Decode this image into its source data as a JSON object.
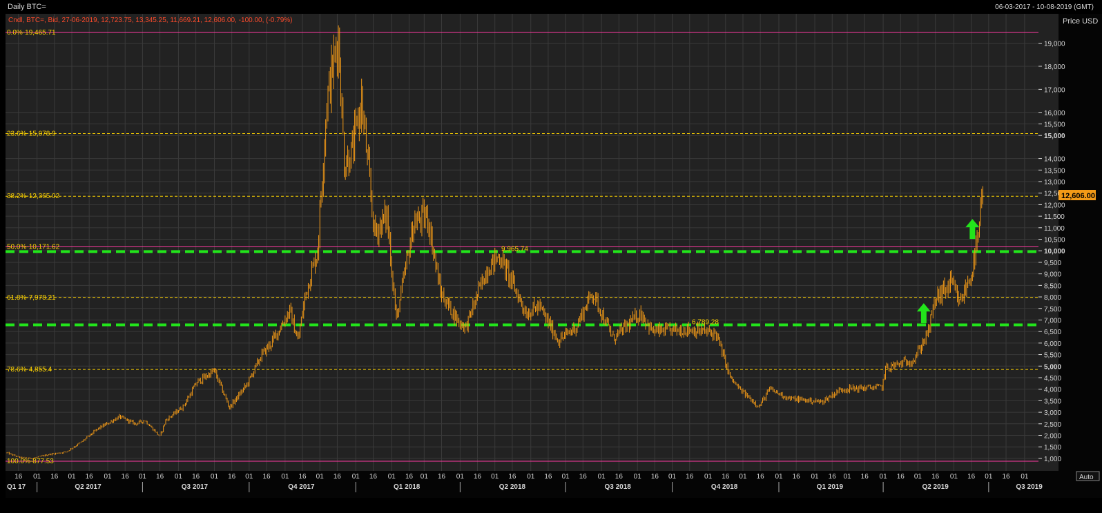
{
  "window": {
    "title": "Daily BTC=",
    "date_range": "06-03-2017 - 10-08-2019 (GMT)",
    "info": "Cndl, BTC=, Bid, 27-06-2019, 12,723.75, 13,345.25, 11,669.21, 12,606.00, -100.00, (-0.79%)"
  },
  "colors": {
    "background": "#000000",
    "plot_background": "#222222",
    "grid": "#3a3a3a",
    "candle": "#f39a17",
    "fibonacci": "#ffd400",
    "fib_end": "#ff3aa1",
    "support": "#22e51b",
    "text": "#d8d8d8",
    "info": "#ff4b2b"
  },
  "chart_data": {
    "type": "candlestick",
    "title": "Daily BTC=",
    "ylabel": "Price USD",
    "last_price": "12,606.00",
    "y_axis_mode": "Auto",
    "ylim": [
      650,
      19700
    ],
    "x_range": [
      "2017-03-06",
      "2019-08-10"
    ],
    "y_ticks": [
      {
        "label": "19,000",
        "value": 19000
      },
      {
        "label": "18,000",
        "value": 18000
      },
      {
        "label": "17,000",
        "value": 17000
      },
      {
        "label": "16,000",
        "value": 16000
      },
      {
        "label": "15,500",
        "value": 15500
      },
      {
        "label": "15,000",
        "value": 15000
      },
      {
        "label": "14,000",
        "value": 14000
      },
      {
        "label": "13,500",
        "value": 13500
      },
      {
        "label": "13,000",
        "value": 13000
      },
      {
        "label": "12,500",
        "value": 12500
      },
      {
        "label": "12,000",
        "value": 12000
      },
      {
        "label": "11,500",
        "value": 11500
      },
      {
        "label": "11,000",
        "value": 11000
      },
      {
        "label": "10,500",
        "value": 10500
      },
      {
        "label": "10,000",
        "value": 10000
      },
      {
        "label": "9,500",
        "value": 9500
      },
      {
        "label": "9,000",
        "value": 9000
      },
      {
        "label": "8,500",
        "value": 8500
      },
      {
        "label": "8,000",
        "value": 8000
      },
      {
        "label": "7,500",
        "value": 7500
      },
      {
        "label": "7,000",
        "value": 7000
      },
      {
        "label": "6,500",
        "value": 6500
      },
      {
        "label": "6,000",
        "value": 6000
      },
      {
        "label": "5,500",
        "value": 5500
      },
      {
        "label": "5,000",
        "value": 5000
      },
      {
        "label": "4,500",
        "value": 4500
      },
      {
        "label": "4,000",
        "value": 4000
      },
      {
        "label": "3,500",
        "value": 3500
      },
      {
        "label": "3,000",
        "value": 3000
      },
      {
        "label": "2,500",
        "value": 2500
      },
      {
        "label": "2,000",
        "value": 2000
      },
      {
        "label": "1,500",
        "value": 1500
      },
      {
        "label": "1,000",
        "value": 1000
      }
    ],
    "fibonacci_levels": [
      {
        "label": "0.0%",
        "value": 19465.71,
        "value_label": "19,465.71",
        "style": "solid"
      },
      {
        "label": "23.6%",
        "value": 15078.9,
        "value_label": "15,078.9",
        "style": "dashed"
      },
      {
        "label": "38.2%",
        "value": 12365.02,
        "value_label": "12,365.02",
        "style": "dashed"
      },
      {
        "label": "50.0%",
        "value": 10171.62,
        "value_label": "10,171.62",
        "style": "solid"
      },
      {
        "label": "61.8%",
        "value": 7978.21,
        "value_label": "7,978.21",
        "style": "dashed"
      },
      {
        "label": "78.6%",
        "value": 4855.4,
        "value_label": "4,855.4",
        "style": "dashed"
      },
      {
        "label": "100.0%",
        "value": 877.53,
        "value_label": "877.53",
        "style": "solid"
      }
    ],
    "support_lines": [
      {
        "value": 9965.74,
        "label": "9,965.74"
      },
      {
        "value": 6789.28,
        "label": "6,789.28"
      }
    ],
    "arrows": [
      {
        "date": "2019-05-06",
        "value": 7250
      },
      {
        "date": "2019-06-17",
        "value": 10900
      }
    ],
    "quarters": [
      {
        "label": "Q1 17",
        "date": "2017-03-06"
      },
      {
        "label": "Q2 2017",
        "date": "2017-05-15"
      },
      {
        "label": "Q3 2017",
        "date": "2017-08-15"
      },
      {
        "label": "Q4 2017",
        "date": "2017-11-15"
      },
      {
        "label": "Q1 2018",
        "date": "2018-02-14"
      },
      {
        "label": "Q2 2018",
        "date": "2018-05-16"
      },
      {
        "label": "Q3 2018",
        "date": "2018-08-15"
      },
      {
        "label": "Q4 2018",
        "date": "2018-11-15"
      },
      {
        "label": "Q1 2019",
        "date": "2019-02-14"
      },
      {
        "label": "Q2 2019",
        "date": "2019-05-16"
      },
      {
        "label": "Q3 2019",
        "date": "2019-08-05"
      }
    ],
    "quarter_boundaries": [
      "2017-04-01",
      "2017-07-01",
      "2017-10-01",
      "2018-01-01",
      "2018-04-01",
      "2018-07-01",
      "2018-10-01",
      "2019-01-01",
      "2019-04-01",
      "2019-07-01"
    ],
    "x_tick_labels": [
      {
        "label": "16",
        "date": "2017-03-16"
      },
      {
        "label": "01",
        "date": "2017-04-01"
      },
      {
        "label": "16",
        "date": "2017-04-16"
      },
      {
        "label": "01",
        "date": "2017-05-01"
      },
      {
        "label": "16",
        "date": "2017-05-16"
      },
      {
        "label": "01",
        "date": "2017-06-01"
      },
      {
        "label": "16",
        "date": "2017-06-16"
      },
      {
        "label": "01",
        "date": "2017-07-01"
      },
      {
        "label": "16",
        "date": "2017-07-16"
      },
      {
        "label": "01",
        "date": "2017-08-01"
      },
      {
        "label": "16",
        "date": "2017-08-16"
      },
      {
        "label": "01",
        "date": "2017-09-01"
      },
      {
        "label": "16",
        "date": "2017-09-16"
      },
      {
        "label": "01",
        "date": "2017-10-01"
      },
      {
        "label": "16",
        "date": "2017-10-16"
      },
      {
        "label": "01",
        "date": "2017-11-01"
      },
      {
        "label": "16",
        "date": "2017-11-16"
      },
      {
        "label": "01",
        "date": "2017-12-01"
      },
      {
        "label": "16",
        "date": "2017-12-16"
      },
      {
        "label": "01",
        "date": "2018-01-01"
      },
      {
        "label": "16",
        "date": "2018-01-16"
      },
      {
        "label": "01",
        "date": "2018-02-01"
      },
      {
        "label": "16",
        "date": "2018-02-16"
      },
      {
        "label": "01",
        "date": "2018-03-01"
      },
      {
        "label": "16",
        "date": "2018-03-16"
      },
      {
        "label": "01",
        "date": "2018-04-01"
      },
      {
        "label": "16",
        "date": "2018-04-16"
      },
      {
        "label": "01",
        "date": "2018-05-01"
      },
      {
        "label": "16",
        "date": "2018-05-16"
      },
      {
        "label": "01",
        "date": "2018-06-01"
      },
      {
        "label": "16",
        "date": "2018-06-16"
      },
      {
        "label": "01",
        "date": "2018-07-01"
      },
      {
        "label": "16",
        "date": "2018-07-16"
      },
      {
        "label": "01",
        "date": "2018-08-01"
      },
      {
        "label": "16",
        "date": "2018-08-16"
      },
      {
        "label": "01",
        "date": "2018-09-01"
      },
      {
        "label": "16",
        "date": "2018-09-16"
      },
      {
        "label": "01",
        "date": "2018-10-01"
      },
      {
        "label": "16",
        "date": "2018-10-16"
      },
      {
        "label": "01",
        "date": "2018-11-01"
      },
      {
        "label": "16",
        "date": "2018-11-16"
      },
      {
        "label": "01",
        "date": "2018-12-01"
      },
      {
        "label": "16",
        "date": "2018-12-16"
      },
      {
        "label": "01",
        "date": "2019-01-01"
      },
      {
        "label": "16",
        "date": "2019-01-16"
      },
      {
        "label": "01",
        "date": "2019-02-01"
      },
      {
        "label": "16",
        "date": "2019-02-16"
      },
      {
        "label": "01",
        "date": "2019-03-01"
      },
      {
        "label": "16",
        "date": "2019-03-16"
      },
      {
        "label": "01",
        "date": "2019-04-01"
      },
      {
        "label": "16",
        "date": "2019-04-16"
      },
      {
        "label": "01",
        "date": "2019-05-01"
      },
      {
        "label": "16",
        "date": "2019-05-16"
      },
      {
        "label": "01",
        "date": "2019-06-01"
      },
      {
        "label": "16",
        "date": "2019-06-16"
      },
      {
        "label": "01",
        "date": "2019-07-01"
      },
      {
        "label": "16",
        "date": "2019-07-16"
      },
      {
        "label": "01",
        "date": "2019-08-01"
      }
    ],
    "price_points": [
      {
        "date": "2017-03-06",
        "value": 1240
      },
      {
        "date": "2017-03-17",
        "value": 1040
      },
      {
        "date": "2017-03-28",
        "value": 1000
      },
      {
        "date": "2017-04-12",
        "value": 1180
      },
      {
        "date": "2017-04-26",
        "value": 1280
      },
      {
        "date": "2017-05-09",
        "value": 1700
      },
      {
        "date": "2017-05-24",
        "value": 2300
      },
      {
        "date": "2017-06-11",
        "value": 2800
      },
      {
        "date": "2017-06-25",
        "value": 2500
      },
      {
        "date": "2017-07-03",
        "value": 2650
      },
      {
        "date": "2017-07-16",
        "value": 1950
      },
      {
        "date": "2017-07-21",
        "value": 2650
      },
      {
        "date": "2017-08-05",
        "value": 3250
      },
      {
        "date": "2017-08-17",
        "value": 4300
      },
      {
        "date": "2017-09-01",
        "value": 4800
      },
      {
        "date": "2017-09-14",
        "value": 3200
      },
      {
        "date": "2017-09-29",
        "value": 4200
      },
      {
        "date": "2017-10-12",
        "value": 5500
      },
      {
        "date": "2017-10-20",
        "value": 6000
      },
      {
        "date": "2017-11-05",
        "value": 7400
      },
      {
        "date": "2017-11-12",
        "value": 6100
      },
      {
        "date": "2017-11-19",
        "value": 8200
      },
      {
        "date": "2017-11-29",
        "value": 10000
      },
      {
        "date": "2017-12-07",
        "value": 16500
      },
      {
        "date": "2017-12-17",
        "value": 19300
      },
      {
        "date": "2017-12-22",
        "value": 13800
      },
      {
        "date": "2017-12-29",
        "value": 14300
      },
      {
        "date": "2018-01-06",
        "value": 16500
      },
      {
        "date": "2018-01-17",
        "value": 10800
      },
      {
        "date": "2018-01-28",
        "value": 11500
      },
      {
        "date": "2018-02-05",
        "value": 7000
      },
      {
        "date": "2018-02-20",
        "value": 11200
      },
      {
        "date": "2018-03-04",
        "value": 11500
      },
      {
        "date": "2018-03-15",
        "value": 8200
      },
      {
        "date": "2018-03-31",
        "value": 6900
      },
      {
        "date": "2018-04-06",
        "value": 6700
      },
      {
        "date": "2018-04-24",
        "value": 9200
      },
      {
        "date": "2018-05-05",
        "value": 9800
      },
      {
        "date": "2018-05-28",
        "value": 7300
      },
      {
        "date": "2018-06-08",
        "value": 7600
      },
      {
        "date": "2018-06-25",
        "value": 6100
      },
      {
        "date": "2018-07-10",
        "value": 6700
      },
      {
        "date": "2018-07-24",
        "value": 8200
      },
      {
        "date": "2018-08-11",
        "value": 6200
      },
      {
        "date": "2018-09-04",
        "value": 7300
      },
      {
        "date": "2018-09-14",
        "value": 6500
      },
      {
        "date": "2018-10-16",
        "value": 6600
      },
      {
        "date": "2018-11-08",
        "value": 6400
      },
      {
        "date": "2018-11-20",
        "value": 4500
      },
      {
        "date": "2018-11-28",
        "value": 4000
      },
      {
        "date": "2018-12-15",
        "value": 3250
      },
      {
        "date": "2018-12-24",
        "value": 4000
      },
      {
        "date": "2019-01-10",
        "value": 3600
      },
      {
        "date": "2019-02-07",
        "value": 3450
      },
      {
        "date": "2019-02-24",
        "value": 4000
      },
      {
        "date": "2019-03-31",
        "value": 4100
      },
      {
        "date": "2019-04-03",
        "value": 4900
      },
      {
        "date": "2019-04-28",
        "value": 5300
      },
      {
        "date": "2019-05-10",
        "value": 6500
      },
      {
        "date": "2019-05-16",
        "value": 7900
      },
      {
        "date": "2019-05-30",
        "value": 8600
      },
      {
        "date": "2019-06-06",
        "value": 7700
      },
      {
        "date": "2019-06-16",
        "value": 9000
      },
      {
        "date": "2019-06-22",
        "value": 10500
      },
      {
        "date": "2019-06-26",
        "value": 12606
      }
    ]
  }
}
